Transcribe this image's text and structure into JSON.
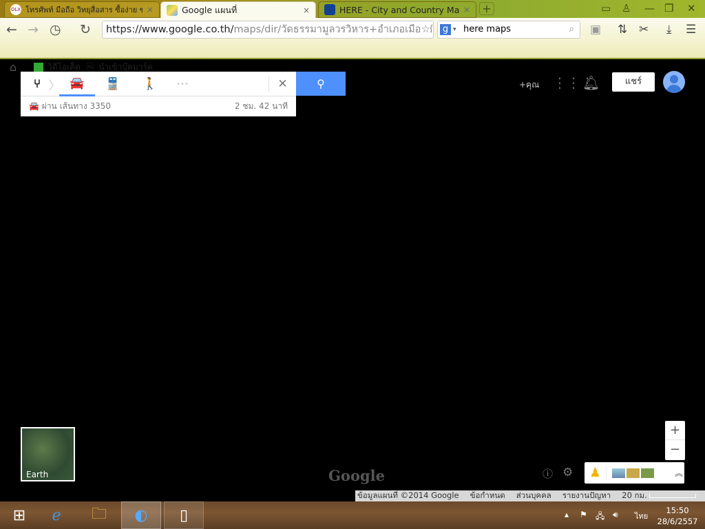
{
  "browser": {
    "tabs": [
      {
        "label": "โทรศัพท์ มือถือ วิทยุสื่อสาร ซื้อง่าย ขา",
        "favicon": "olx-icon",
        "active": false
      },
      {
        "label": "Google แผนที่",
        "favicon": "google-maps-icon",
        "active": true
      },
      {
        "label": "HERE - City and Country Ma",
        "favicon": "here-icon",
        "active": false
      }
    ],
    "close_glyph": "×",
    "new_tab_glyph": "+",
    "url_host": "https://www.google.co.th/",
    "url_path": "maps/dir/วัดธรรมามูลวรวิหาร+อำเภอเมืองชัยนาท+จัง",
    "search_engine": "g",
    "search_value": "here maps",
    "bookmarks": [
      {
        "label": "วิดีโอเด็ด"
      },
      {
        "label": "นำเข้าบุ๊คมาร์ค"
      }
    ]
  },
  "directions": {
    "route_summary": "ผ่าน เส้นทาง 3350",
    "duration": "2 ชม. 42 นาที",
    "more_glyph": "•••",
    "close_glyph": "✕",
    "accent": "#4d90fe"
  },
  "header": {
    "plus_you": "+คุณ",
    "share": "แชร์"
  },
  "map": {
    "earth_label": "Earth",
    "logo": "Google",
    "zoom_in": "+",
    "zoom_out": "−",
    "footer": {
      "data": "ข้อมูลแผนที่ ©2014 Google",
      "terms": "ข้อกำหนด",
      "privacy": "ส่วนบุคคล",
      "report": "รายงานปัญหา",
      "scale": "20 กม."
    }
  },
  "taskbar": {
    "language": "ไทย",
    "time": "15:50",
    "date": "28/6/2557"
  }
}
